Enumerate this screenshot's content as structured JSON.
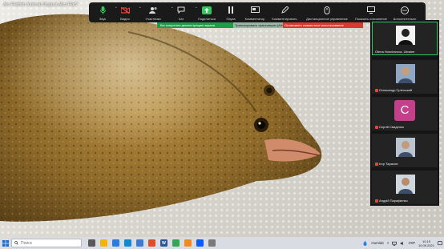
{
  "video": {
    "title": "Are Flatfish Internal Organs Also Flat?"
  },
  "toolbar": {
    "items": [
      {
        "label": "Звук",
        "icon": "microphone-icon",
        "color": "#2fc85a"
      },
      {
        "label": "Видео",
        "icon": "video-off-icon",
        "color": "#e8463a"
      },
      {
        "label": "Участники",
        "icon": "participants-icon"
      },
      {
        "label": "Чат",
        "icon": "chat-icon"
      },
      {
        "label": "Поделиться",
        "icon": "share-screen-icon",
        "color": "#2fc85a"
      },
      {
        "label": "Пауза",
        "icon": "pause-icon"
      },
      {
        "label": "Комментатор",
        "icon": "annotate-icon"
      },
      {
        "label": "Комментировать",
        "icon": "pencil-icon"
      },
      {
        "label": "Дистанционное управление",
        "icon": "remote-control-icon"
      },
      {
        "label": "Показать сохранение",
        "icon": "show-icon"
      },
      {
        "label": "Дополнительно",
        "icon": "more-icon"
      }
    ],
    "banner_sharing": "Вы запустили демонстрацию экрана",
    "banner_broadcast": "Транслировать трансляцию (Alt+S)",
    "banner_stop": "Остановить совместное использование"
  },
  "participants": [
    {
      "name": "Olena Honcharova, Ukraine",
      "muted": false,
      "type": "photo",
      "active": true
    },
    {
      "name": "Олександр Гулінський",
      "muted": true,
      "type": "photo",
      "active": false
    },
    {
      "name": "Сергій Свиденко",
      "muted": true,
      "type": "initial",
      "initial": "С",
      "active": false
    },
    {
      "name": "Ігор Тарасов",
      "muted": true,
      "type": "photo",
      "active": false
    },
    {
      "name": "Андрій Парафієнко",
      "muted": true,
      "type": "photo",
      "active": false
    }
  ],
  "taskbar": {
    "search_placeholder": "Поиск",
    "weather": "Humide",
    "language": "УКР",
    "time": "10:15",
    "date": "10.09.2021"
  },
  "colors": {
    "zoom_green": "#2fc85a",
    "stop_red": "#d63a30",
    "avatar_pink": "#c2418a"
  }
}
